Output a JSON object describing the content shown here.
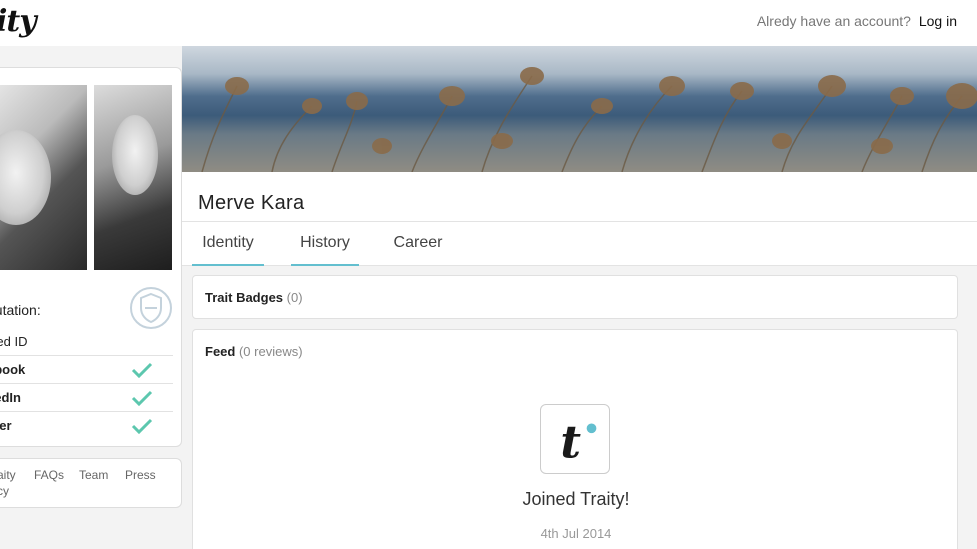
{
  "header": {
    "logo_text": "ity",
    "login_prompt": "Alredy have an account?",
    "login_link": "Log in"
  },
  "sidebar": {
    "reputation_label": "putation:",
    "traits": [
      {
        "label": "ified ID",
        "bold": false,
        "verified": false
      },
      {
        "label": "ebook",
        "bold": true,
        "verified": true
      },
      {
        "label": "kedIn",
        "bold": true,
        "verified": true
      },
      {
        "label": "itter",
        "bold": true,
        "verified": true
      }
    ],
    "footer_links": [
      "aity",
      "FAQs",
      "Team",
      "Press"
    ],
    "footer_links_row2": [
      "cy"
    ]
  },
  "profile": {
    "name": "Merve Kara",
    "tabs": [
      {
        "label": "Identity",
        "active": true
      },
      {
        "label": "History",
        "active": true
      },
      {
        "label": "Career",
        "active": false
      }
    ]
  },
  "badges": {
    "title": "Trait Badges",
    "count": "(0)"
  },
  "feed": {
    "title": "Feed",
    "count": "(0 reviews)",
    "event_text": "Joined Traity!",
    "event_date": "4th Jul 2014",
    "icon_letter": "t"
  },
  "colors": {
    "accent": "#63bfcf",
    "check": "#5cc7ae"
  },
  "icons": {
    "shield": "shield-icon",
    "check": "checkmark-icon",
    "traity": "traity-logo-icon"
  }
}
